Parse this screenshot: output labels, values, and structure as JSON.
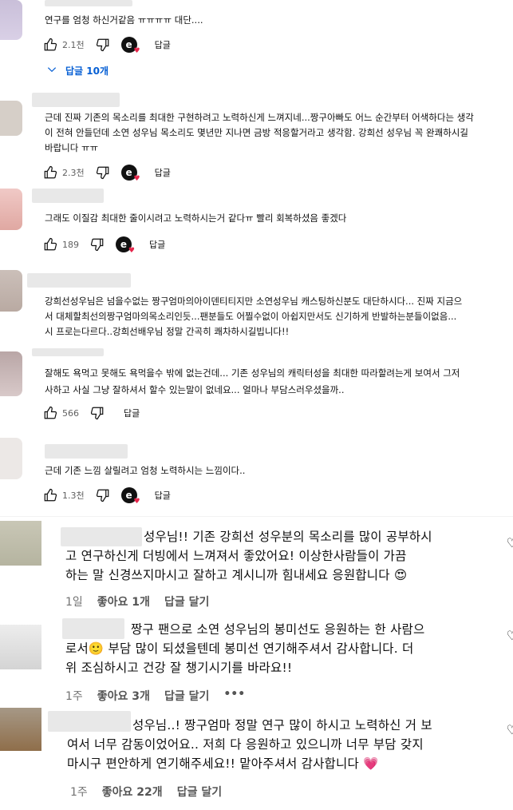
{
  "youtube_comments": [
    {
      "lines": [
        "연구를 엄청 하신거같음 ㅠㅠㅠㅠ 대단...."
      ],
      "likes": "2.1천",
      "reply_label": "답글",
      "more_replies": "답글 10개"
    },
    {
      "lines": [
        "근데 진짜 기존의 목소리를 최대한 구현하려고 노력하신게 느껴지네...짱구아빠도 어느 순간부터 어색하다는 생각",
        "이 전혀 안들던데 소연 성우님 목소리도 몇년만 지나면 금방 적응할거라고 생각함. 강희선 성우님 꼭 완쾌하시길",
        "바랍니다 ㅠㅠ"
      ],
      "likes": "2.3천",
      "reply_label": "답글"
    },
    {
      "lines": [
        "그래도 이질감 최대한 줄이시려고 노력하시는거 같다ㅠ 빨리 회복하셨음 좋겠다"
      ],
      "likes": "189",
      "reply_label": "답글"
    },
    {
      "lines": [
        "강희선성우님은 넘을수없는 짱구엄마의아이덴티티지만 소연성우님 캐스팅하신분도 대단하시다... 진짜 지금으",
        "서 대체할최선의짱구엄마의목소리인듯...팬분들도 어찔수없이 아쉽지만서도 신기하게 반발하는분들이없음...",
        "시 프로는다르다..강희선배우님 정말 간곡히 쾌차하시길빕니다!!"
      ],
      "likes": "",
      "reply_label": ""
    },
    {
      "lines": [
        "잘해도 욕먹고 못해도 욕먹을수 밖에 없는건데... 기존 성우님의 캐릭터성을 최대한 따라할려는게 보여서 그저",
        "사하고 사실 그냥 잘하셔서 할수 있는말이 없네요... 얼마나 부담스러우셨을까.."
      ],
      "likes": "566",
      "reply_label": "답글"
    },
    {
      "lines": [
        "근데 기존 느낌 살릴려고 엄청 노력하시는 느낌이다.."
      ],
      "likes": "1.3천",
      "reply_label": "답글"
    }
  ],
  "instagram_comments": [
    {
      "lines": [
        "성우님!! 기존 강희선 성우분의 목소리를 많이 공부하시",
        "고 연구하신게 더빙에서 느껴져서 좋았어요! 이상한사람들이 가끔",
        "하는 말 신경쓰지마시고 잘하고 계시니까 힘내세요 응원합니다 😍"
      ],
      "time": "1일",
      "likes": "좋아요 1개",
      "reply": "답글 달기",
      "more": ""
    },
    {
      "lines": [
        "짱구 팬으로 소연 성우님의 봉미선도 응원하는 한 사람으",
        "로서🙂 부담 많이 되셨을텐데 봉미선 연기해주셔서 감사합니다. 더",
        "위 조심하시고 건강 잘 챙기시기를 바라요!!"
      ],
      "time": "1주",
      "likes": "좋아요 3개",
      "reply": "답글 달기",
      "more": "•••"
    },
    {
      "lines": [
        "성우님..! 짱구엄마 정말 연구 많이 하시고 노력하신 거 보",
        "여서 너무 감동이었어요.. 저희 다 응원하고 있으니까 너무 부담 갖지",
        "마시구 편안하게 연기해주세요!! 맡아주셔서 감사합니다 💗"
      ],
      "time": "1주",
      "likes": "좋아요 22개",
      "reply": "답글 달기",
      "more": ""
    }
  ],
  "creator_badge": "e",
  "colors": {
    "link_blue": "#065fd4",
    "heart_red": "#e5264b",
    "meta_gray": "#737373"
  }
}
